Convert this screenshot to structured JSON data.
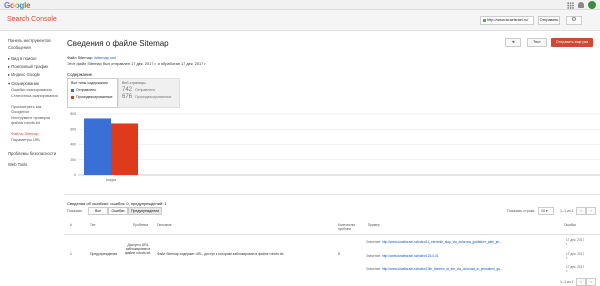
{
  "topbar": {
    "logo": "Google"
  },
  "subbar": {
    "product": "Search Console",
    "site": "http://www.israelsrael.ru/",
    "share_label": "Отправить",
    "gear_glyph": "⚙"
  },
  "sidebar": {
    "items": [
      {
        "label": "Панель инструментов"
      },
      {
        "label": "Сообщения"
      },
      {
        "label": "▸ Вид в поиске"
      },
      {
        "label": "▸ Поисковый трафик"
      },
      {
        "label": "▸ Индекс Google"
      },
      {
        "label": "▾ Сканирование"
      }
    ],
    "subitems": [
      "Ошибки сканирования",
      "Статистика сканирования",
      "Просмотреть как Googlebot",
      "Инструмент проверки файла robots.txt",
      "Файлы Sitemap",
      "Параметры URL"
    ],
    "bottom_items": [
      "Проблемы безопасности",
      "Web Tools"
    ]
  },
  "header": {
    "title": "Сведения о файле Sitemap",
    "back_glyph": "◂",
    "test_label": "Тест",
    "resubmit_label": "Отправить еще раз"
  },
  "meta": {
    "file_label": "Файл Sitemap:",
    "file_link": "/sitemap.xml",
    "submitted": "Этот файл Sitemap был отправлен 17 дек. 2017 г. и обработан 17 дек. 2017 г."
  },
  "content": {
    "section_title": "Содержание",
    "types_header": "Все типы содержания",
    "legend": [
      {
        "label": "Отправлено",
        "color": "#3a6fd8"
      },
      {
        "label": "Проиндексированные",
        "color": "#dd3b1c"
      }
    ],
    "stats_header": "Веб-страницы",
    "stats": [
      {
        "num": "742",
        "label": "Отправлено"
      },
      {
        "num": "676",
        "label": "Проиндексированные"
      }
    ]
  },
  "chart_data": {
    "type": "bar",
    "categories": [
      "Images"
    ],
    "series": [
      {
        "name": "Отправлено",
        "values": [
          742
        ],
        "color": "#3a6fd8"
      },
      {
        "name": "Проиндексированные",
        "values": [
          676
        ],
        "color": "#dd3b1c"
      }
    ],
    "yticks": [
      "800",
      "600",
      "400",
      "200",
      "0"
    ],
    "ylim": [
      0,
      800
    ]
  },
  "issues": {
    "title": "Сведения об ошибках: ошибок: 0, предупреждений: 1",
    "show_label": "Показать",
    "filters": [
      "Все",
      "Ошибки",
      "Предупреждения"
    ],
    "per_page_label": "Показать строки:",
    "per_page_value": "10 ▾",
    "range_label": "1–1 из 1",
    "prev_glyph": "‹",
    "next_glyph": "›",
    "columns": [
      "#",
      "Тип",
      "Проблема",
      "Описание",
      "Количество проблем",
      "Пример",
      "Ошибка"
    ],
    "row": {
      "num": "1",
      "type": "Предупреждения",
      "issue": "Доступ к URL заблокирован в файле robots.txt.",
      "desc": "Файл Sitemap содержит URL, доступ к которым заблокирован в файле robots.txt.",
      "count": "5",
      "examples": [
        {
          "label": "Значение:",
          "url": "http://www.israelisrael.ru/index/11_eleventh_stop_via_dolorosa_godfather_path_jer...",
          "date": "17 дек. 2017 г."
        },
        {
          "label": "Значение:",
          "url": "http://www.israelisrael.ru/index/123-0-01",
          "date": "17 дек. 2017 г."
        },
        {
          "label": "Значение:",
          "url": "http://www.israelisrael.ru/index/13th_thirteen_st_the_via_dolorosa_in_jerusalem_gu...",
          "date": "17 дек. 2017 г."
        }
      ]
    }
  }
}
